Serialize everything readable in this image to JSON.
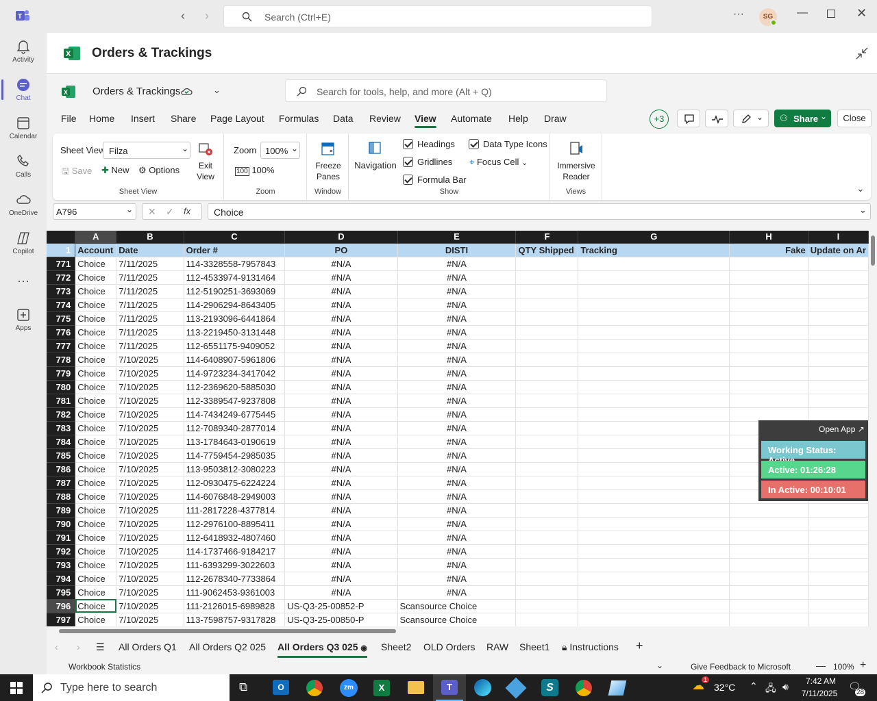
{
  "titlebar": {
    "search_placeholder": "Search (Ctrl+E)",
    "avatar": "SG"
  },
  "rail": [
    {
      "label": "Activity",
      "icon": "bell-icon"
    },
    {
      "label": "Chat",
      "icon": "chat-icon"
    },
    {
      "label": "Calendar",
      "icon": "calendar-icon"
    },
    {
      "label": "Calls",
      "icon": "phone-icon"
    },
    {
      "label": "OneDrive",
      "icon": "cloud-icon"
    },
    {
      "label": "Copilot",
      "icon": "copilot-icon"
    },
    {
      "label": "Apps",
      "icon": "apps-icon"
    }
  ],
  "header": {
    "title": "Orders & Trackings"
  },
  "excel": {
    "filename": "Orders & Trackings",
    "search_placeholder": "Search for tools, help, and more (Alt + Q)",
    "collab_count": "+3",
    "share": "Share",
    "close": "Close"
  },
  "tabs": [
    "File",
    "Home",
    "Insert",
    "Share",
    "Page Layout",
    "Formulas",
    "Data",
    "Review",
    "View",
    "Automate",
    "Help",
    "Draw"
  ],
  "ribbon": {
    "sheetview": {
      "label": "Sheet View",
      "value": "Filza",
      "save": "Save",
      "new": "New",
      "options": "Options",
      "exit1": "Exit",
      "exit2": "View",
      "group": "Sheet View"
    },
    "zoom": {
      "label": "Zoom",
      "value": "100%",
      "hundred": "100%",
      "group": "Zoom"
    },
    "window": {
      "freeze1": "Freeze",
      "freeze2": "Panes",
      "group": "Window"
    },
    "show": {
      "navigation": "Navigation",
      "headings": "Headings",
      "gridlines": "Gridlines",
      "formula_bar": "Formula Bar",
      "data_type_icons": "Data Type Icons",
      "focus_cell": "Focus Cell",
      "group": "Show"
    },
    "views": {
      "imm1": "Immersive",
      "imm2": "Reader",
      "group": "Views"
    }
  },
  "formula": {
    "namebox": "A796",
    "content": "Choice",
    "fx": "fx"
  },
  "columns": [
    "A",
    "B",
    "C",
    "D",
    "E",
    "F",
    "G",
    "H",
    "I"
  ],
  "header_row": {
    "num": "1",
    "cells": [
      "Account",
      "Date",
      "Order #",
      "PO",
      "DISTI",
      "QTY Shipped",
      "Tracking",
      "Fake",
      "Update on Ar"
    ]
  },
  "rows": [
    {
      "n": "771",
      "a": "Choice",
      "b": "7/11/2025",
      "c": "114-3328558-7957843",
      "d": "#N/A",
      "e": "#N/A"
    },
    {
      "n": "772",
      "a": "Choice",
      "b": "7/11/2025",
      "c": "112-4533974-9131464",
      "d": "#N/A",
      "e": "#N/A"
    },
    {
      "n": "773",
      "a": "Choice",
      "b": "7/11/2025",
      "c": "112-5190251-3693069",
      "d": "#N/A",
      "e": "#N/A"
    },
    {
      "n": "774",
      "a": "Choice",
      "b": "7/11/2025",
      "c": "114-2906294-8643405",
      "d": "#N/A",
      "e": "#N/A"
    },
    {
      "n": "775",
      "a": "Choice",
      "b": "7/11/2025",
      "c": "113-2193096-6441864",
      "d": "#N/A",
      "e": "#N/A"
    },
    {
      "n": "776",
      "a": "Choice",
      "b": "7/11/2025",
      "c": "113-2219450-3131448",
      "d": "#N/A",
      "e": "#N/A"
    },
    {
      "n": "777",
      "a": "Choice",
      "b": "7/11/2025",
      "c": "112-6551175-9409052",
      "d": "#N/A",
      "e": "#N/A"
    },
    {
      "n": "778",
      "a": "Choice",
      "b": "7/10/2025",
      "c": "114-6408907-5961806",
      "d": "#N/A",
      "e": "#N/A"
    },
    {
      "n": "779",
      "a": "Choice",
      "b": "7/10/2025",
      "c": "114-9723234-3417042",
      "d": "#N/A",
      "e": "#N/A"
    },
    {
      "n": "780",
      "a": "Choice",
      "b": "7/10/2025",
      "c": "112-2369620-5885030",
      "d": "#N/A",
      "e": "#N/A"
    },
    {
      "n": "781",
      "a": "Choice",
      "b": "7/10/2025",
      "c": "112-3389547-9237808",
      "d": "#N/A",
      "e": "#N/A"
    },
    {
      "n": "782",
      "a": "Choice",
      "b": "7/10/2025",
      "c": "114-7434249-6775445",
      "d": "#N/A",
      "e": "#N/A"
    },
    {
      "n": "783",
      "a": "Choice",
      "b": "7/10/2025",
      "c": "112-7089340-2877014",
      "d": "#N/A",
      "e": "#N/A"
    },
    {
      "n": "784",
      "a": "Choice",
      "b": "7/10/2025",
      "c": "113-1784643-0190619",
      "d": "#N/A",
      "e": "#N/A"
    },
    {
      "n": "785",
      "a": "Choice",
      "b": "7/10/2025",
      "c": "114-7759454-2985035",
      "d": "#N/A",
      "e": "#N/A"
    },
    {
      "n": "786",
      "a": "Choice",
      "b": "7/10/2025",
      "c": "113-9503812-3080223",
      "d": "#N/A",
      "e": "#N/A"
    },
    {
      "n": "787",
      "a": "Choice",
      "b": "7/10/2025",
      "c": "112-0930475-6224224",
      "d": "#N/A",
      "e": "#N/A"
    },
    {
      "n": "788",
      "a": "Choice",
      "b": "7/10/2025",
      "c": "114-6076848-2949003",
      "d": "#N/A",
      "e": "#N/A"
    },
    {
      "n": "789",
      "a": "Choice",
      "b": "7/10/2025",
      "c": "111-2817228-4377814",
      "d": "#N/A",
      "e": "#N/A"
    },
    {
      "n": "790",
      "a": "Choice",
      "b": "7/10/2025",
      "c": "112-2976100-8895411",
      "d": "#N/A",
      "e": "#N/A"
    },
    {
      "n": "791",
      "a": "Choice",
      "b": "7/10/2025",
      "c": "112-6418932-4807460",
      "d": "#N/A",
      "e": "#N/A"
    },
    {
      "n": "792",
      "a": "Choice",
      "b": "7/10/2025",
      "c": "114-1737466-9184217",
      "d": "#N/A",
      "e": "#N/A"
    },
    {
      "n": "793",
      "a": "Choice",
      "b": "7/10/2025",
      "c": "111-6393299-3022603",
      "d": "#N/A",
      "e": "#N/A"
    },
    {
      "n": "794",
      "a": "Choice",
      "b": "7/10/2025",
      "c": "112-2678340-7733864",
      "d": "#N/A",
      "e": "#N/A"
    },
    {
      "n": "795",
      "a": "Choice",
      "b": "7/10/2025",
      "c": "111-9062453-9361003",
      "d": "#N/A",
      "e": "#N/A"
    },
    {
      "n": "796",
      "a": "Choice",
      "b": "7/10/2025",
      "c": "111-2126015-6989828",
      "d": "US-Q3-25-00852-P",
      "e": "Scansource Choice"
    },
    {
      "n": "797",
      "a": "Choice",
      "b": "7/10/2025",
      "c": "113-7598757-9317828",
      "d": "US-Q3-25-00850-P",
      "e": "Scansource Choice"
    }
  ],
  "sheets": [
    "All Orders Q1",
    "All Orders Q2 025",
    "All Orders Q3 025",
    "Sheet2",
    "OLD Orders",
    "RAW",
    "Sheet1",
    "Instructions"
  ],
  "status": {
    "stats": "Workbook Statistics",
    "feedback": "Give Feedback to Microsoft",
    "zoom": "100%"
  },
  "widget": {
    "open": "Open App",
    "working": "Working Status: Active",
    "active": "Active: 01:26:28",
    "inactive": "In Active: 00:10:01"
  },
  "taskbar": {
    "search_placeholder": "Type here to search",
    "temp": "32°C",
    "time": "7:42 AM",
    "date": "7/11/2025",
    "notif": "28",
    "weather_badge": "1"
  },
  "colors": {
    "excel_green": "#217346",
    "teams_purple": "#5b5fc7",
    "header_fill": "#b8d7f0",
    "widget_active": "#58d68d",
    "widget_inactive": "#e8706a",
    "widget_status": "#7ac7d0"
  }
}
